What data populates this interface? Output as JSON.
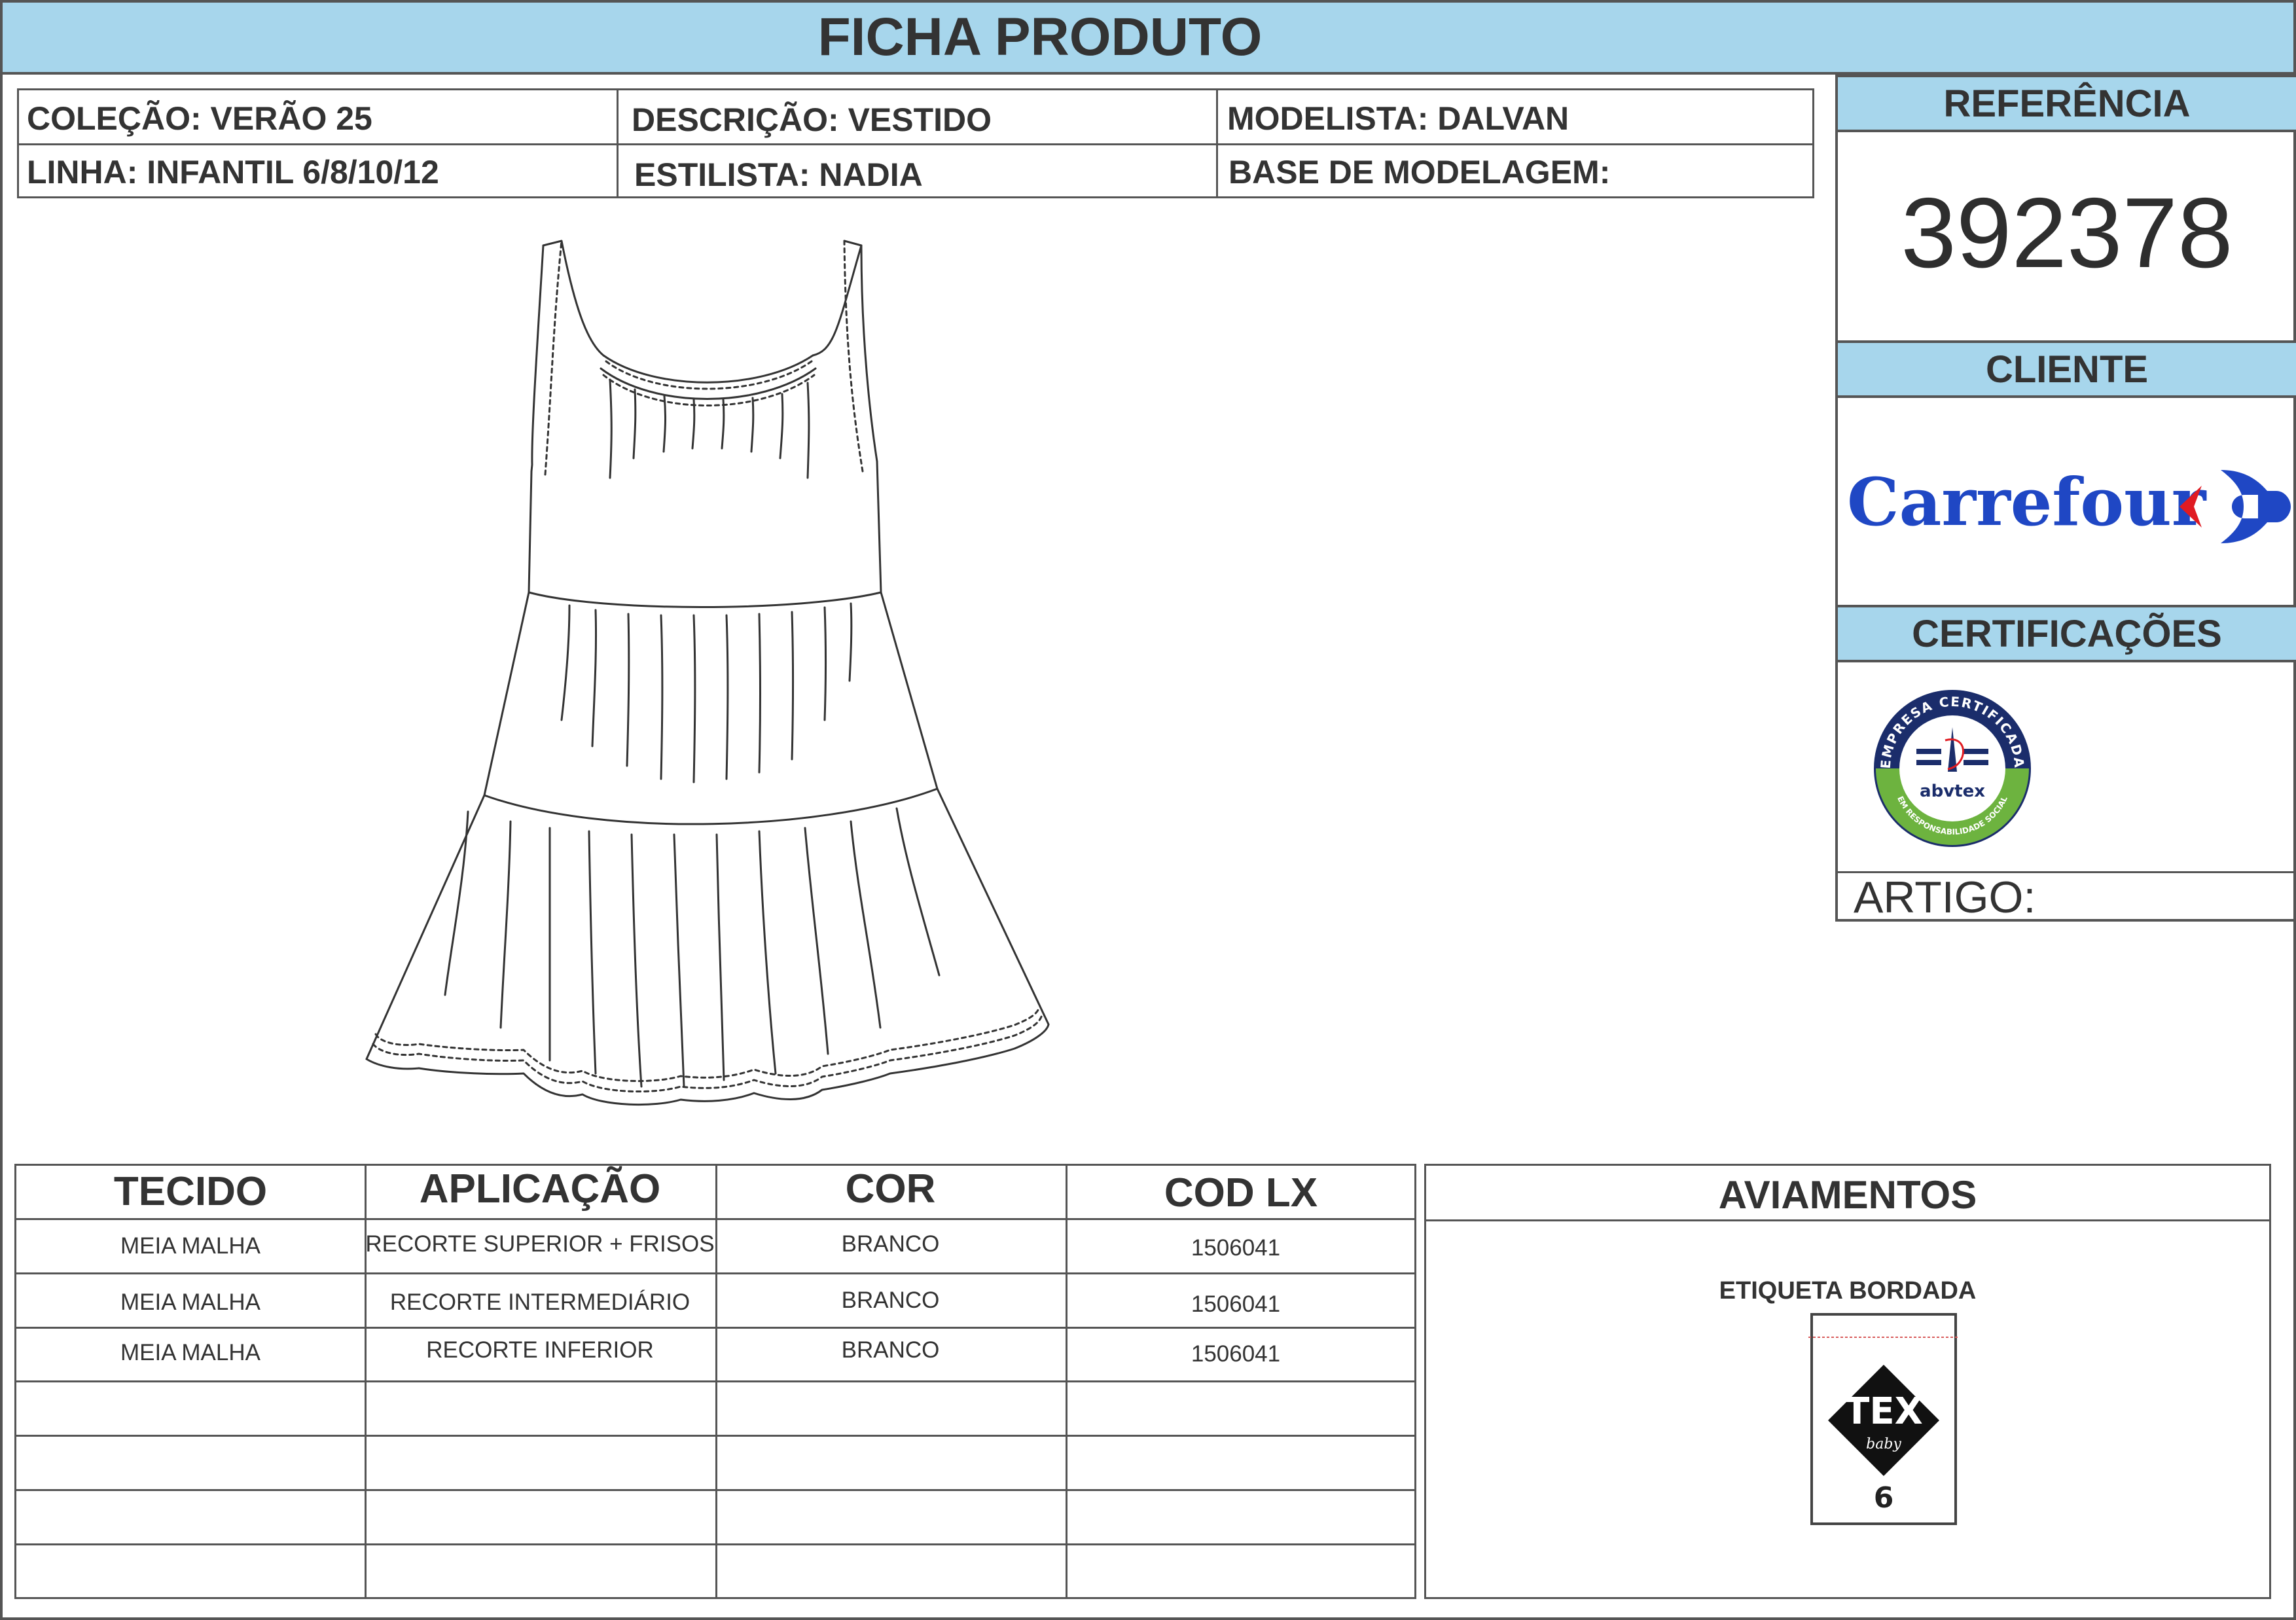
{
  "header": {
    "title": "FICHA PRODUTO"
  },
  "info": {
    "colecao": "COLEÇÃO: VERÃO 25",
    "descricao": "DESCRIÇÃO: VESTIDO",
    "modelista": "MODELISTA: DALVAN",
    "linha": "LINHA: INFANTIL 6/8/10/12",
    "estilista": "ESTILISTA: NADIA",
    "base": "BASE DE MODELAGEM:"
  },
  "sidebar": {
    "referencia_label": "REFERÊNCIA",
    "referencia_value": "392378",
    "cliente_label": "CLIENTE",
    "cliente_logo_text": "Carrefour",
    "certificacoes_label": "CERTIFICAÇÕES",
    "cert_ring_text_top": "EMPRESA CERTIFICADA",
    "cert_ring_text_bottom": "EM RESPONSABILIDADE SOCIAL",
    "cert_brand": "abvtex",
    "artigo_label": "ARTIGO:"
  },
  "fabric_table": {
    "headers": [
      "TECIDO",
      "APLICAÇÃO",
      "COR",
      "COD LX"
    ],
    "rows": [
      [
        "MEIA MALHA",
        "RECORTE SUPERIOR + FRISOS",
        "BRANCO",
        "1506041"
      ],
      [
        "MEIA MALHA",
        "RECORTE INTERMEDIÁRIO",
        "BRANCO",
        "1506041"
      ],
      [
        "MEIA MALHA",
        "RECORTE INFERIOR",
        "BRANCO",
        "1506041"
      ]
    ]
  },
  "aviamentos": {
    "title": "AVIAMENTOS",
    "item_label": "ETIQUETA BORDADA",
    "label_brand": "TEX",
    "label_sub": "baby",
    "label_size": "6"
  },
  "colors": {
    "header_blue": "#a7d6ec",
    "carrefour_blue": "#1f47c4",
    "carrefour_red": "#e01b22",
    "abvtex_navy": "#1b2d6b",
    "abvtex_green": "#6db33f"
  }
}
